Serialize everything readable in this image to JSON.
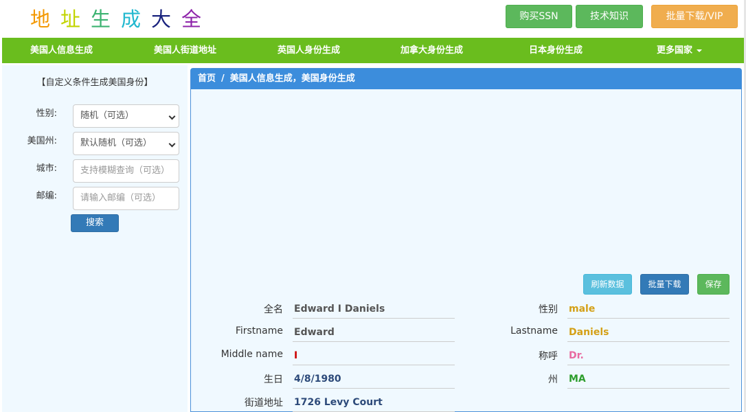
{
  "header": {
    "logo_chars": [
      "地",
      "址",
      "生",
      "成",
      "大",
      "全"
    ],
    "logo_colors": [
      "#f39800",
      "#c2d400",
      "#3cb371",
      "#22b8cf",
      "#1a237e",
      "#8e24aa"
    ],
    "buy_ssn": "购买SSN",
    "tech": "技术知识",
    "batch_vip": "批量下载/VIP"
  },
  "nav": {
    "items": [
      "美国人信息生成",
      "美国人街道地址",
      "英国人身份生成",
      "加拿大身份生成",
      "日本身份生成",
      "更多国家"
    ]
  },
  "sidebar": {
    "title": "【自定义条件生成美国身份】",
    "gender_label": "性别:",
    "gender_value": "随机（可选）",
    "state_label": "美国州:",
    "state_value": "默认随机（可选）",
    "city_label": "城市:",
    "city_placeholder": "支持模糊查询（可选）",
    "zip_label": "邮编:",
    "zip_placeholder": "请输入邮编（可选）",
    "search": "搜索"
  },
  "main": {
    "breadcrumb_home": "首页",
    "breadcrumb_sep": "/",
    "breadcrumb_current": "美国人信息生成，美国身份生成",
    "refresh": "刷新数据",
    "batch": "批量下载",
    "save": "保存"
  },
  "record": {
    "fullname_label": "全名",
    "fullname": "Edward I Daniels",
    "gender_label": "性别",
    "gender": "male",
    "firstname_label": "Firstname",
    "firstname": "Edward",
    "lastname_label": "Lastname",
    "lastname": "Daniels",
    "middle_label": "Middle name",
    "middle": "I",
    "title_label": "称呼",
    "title": "Dr.",
    "birth_label": "生日",
    "birth": "4/8/1980",
    "state_label": "州",
    "state": "MA",
    "street_label": "街道地址",
    "street": "1726 Levy Court"
  },
  "colors": {
    "nav_green": "#6abd1e",
    "breadcrumb_blue": "#3c8ddc",
    "value_gray": "#555555",
    "value_gold": "#d4a017",
    "value_red": "#cc0000",
    "value_pink": "#e86aa0",
    "value_navy": "#2d4a7a",
    "value_green": "#2e9e2e"
  }
}
